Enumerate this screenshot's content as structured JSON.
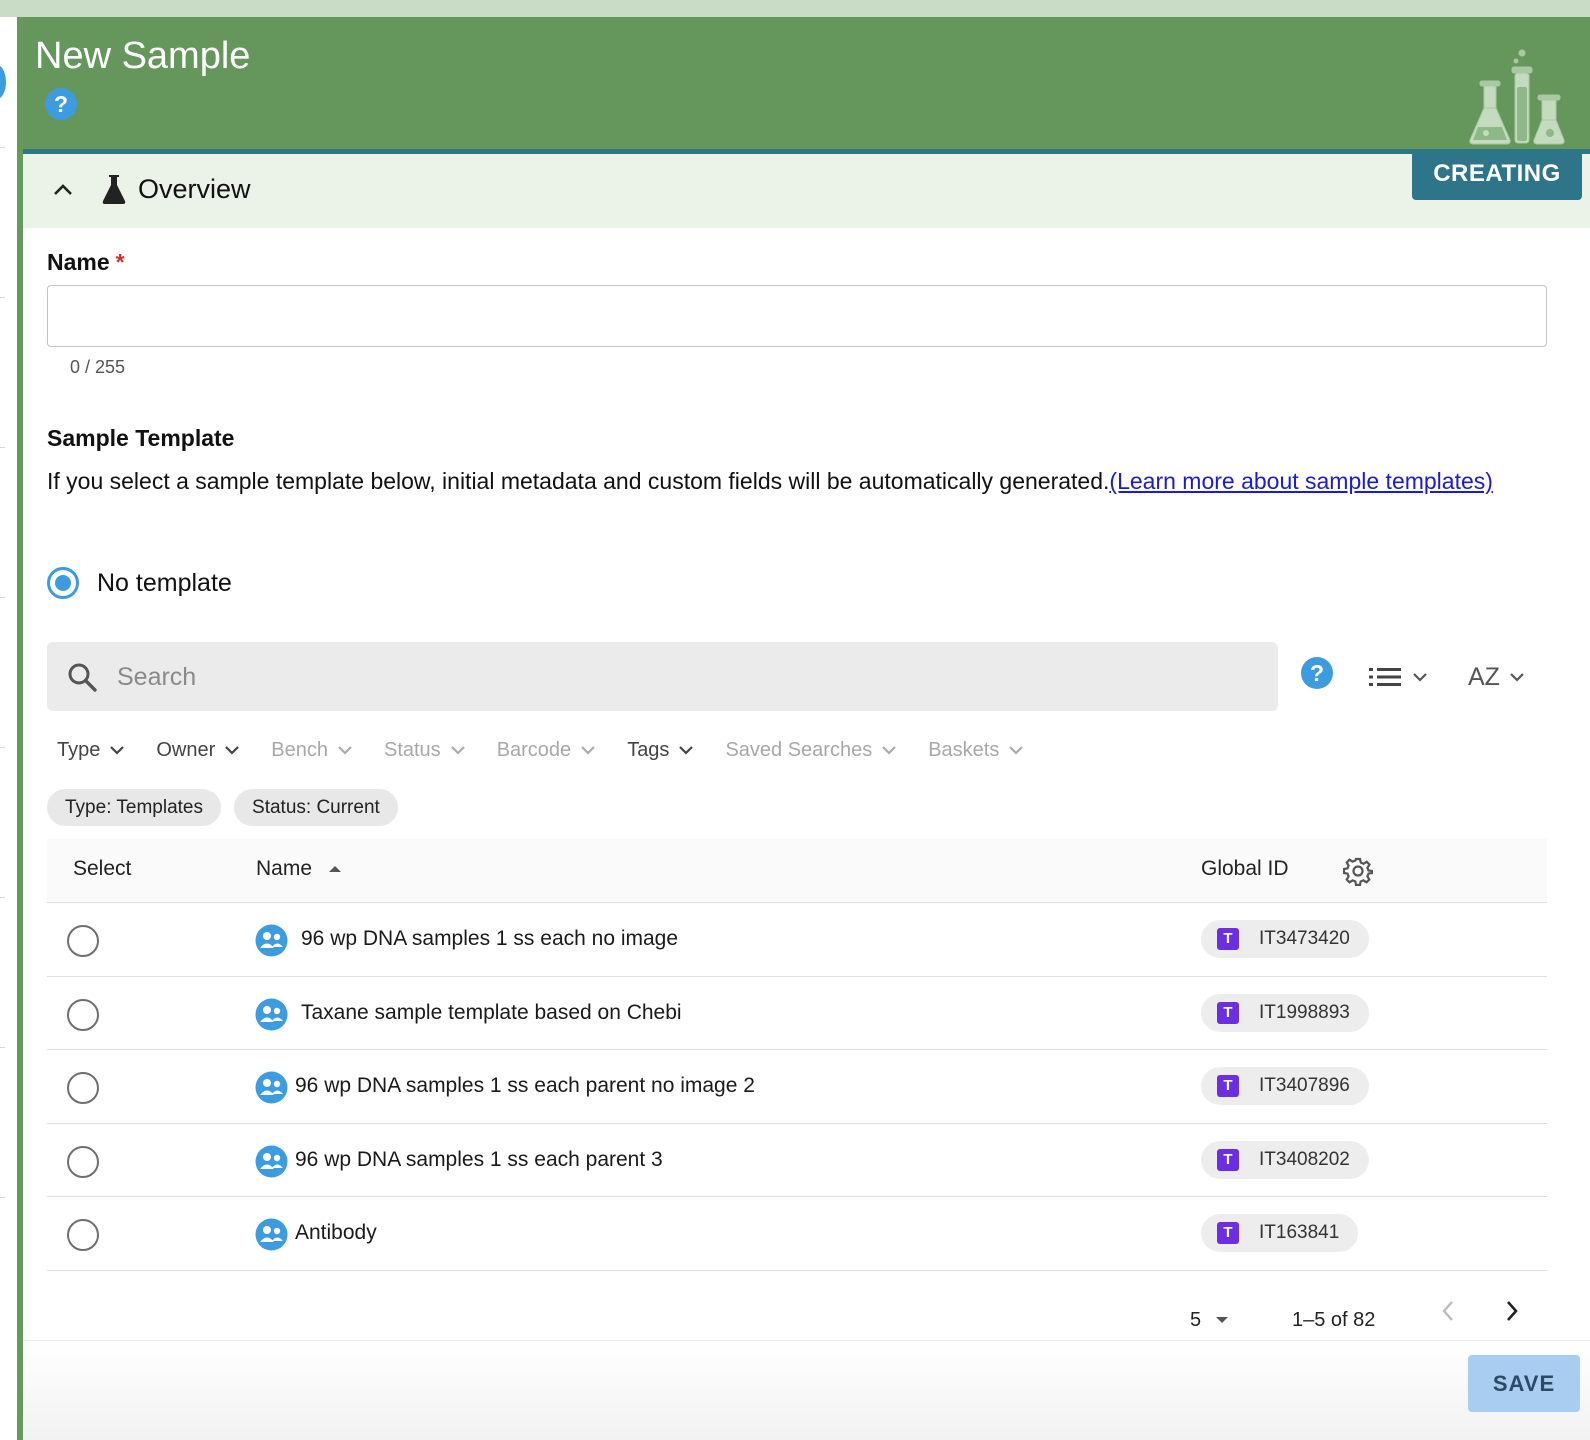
{
  "header": {
    "title": "New Sample",
    "help_glyph": "?",
    "status": "CREATING",
    "colors": {
      "header_bg": "#65975c",
      "accent": "#2f7589",
      "help": "#3d9be0"
    }
  },
  "overview": {
    "label": "Overview"
  },
  "name_field": {
    "label": "Name",
    "required_mark": "*",
    "value": "",
    "counter": "0 / 255"
  },
  "template_section": {
    "title": "Sample Template",
    "description": "If you select a sample template below, initial metadata and custom fields will be automatically generated.",
    "learn_more_link": "(Learn more about sample templates)",
    "no_template_label": "No template",
    "no_template_selected": true
  },
  "search": {
    "placeholder": "Search",
    "help_glyph": "?",
    "view_icon": "list-view-icon",
    "sort_label": "AZ"
  },
  "filters": [
    {
      "label": "Type",
      "enabled": true
    },
    {
      "label": "Owner",
      "enabled": true
    },
    {
      "label": "Bench",
      "enabled": false
    },
    {
      "label": "Status",
      "enabled": false
    },
    {
      "label": "Barcode",
      "enabled": false
    },
    {
      "label": "Tags",
      "enabled": true
    },
    {
      "label": "Saved Searches",
      "enabled": false
    },
    {
      "label": "Baskets",
      "enabled": false
    }
  ],
  "active_chips": [
    "Type: Templates",
    "Status: Current"
  ],
  "table": {
    "columns": {
      "select": "Select",
      "name": "Name",
      "global_id": "Global ID"
    },
    "rows": [
      {
        "name": "96 wp DNA samples 1 ss each no image",
        "type_badge": "T",
        "global_id": "IT3473420"
      },
      {
        "name": "Taxane sample template based on Chebi",
        "type_badge": "T",
        "global_id": "IT1998893"
      },
      {
        "name": "96 wp DNA samples 1 ss each parent no image 2",
        "type_badge": "T",
        "global_id": "IT3407896"
      },
      {
        "name": "96 wp DNA samples 1 ss each parent 3",
        "type_badge": "T",
        "global_id": "IT3408202"
      },
      {
        "name": "Antibody",
        "type_badge": "T",
        "global_id": "IT163841"
      }
    ]
  },
  "pagination": {
    "rows_per_page": "5",
    "range": "1–5 of 82"
  },
  "footer": {
    "save_label": "SAVE"
  }
}
